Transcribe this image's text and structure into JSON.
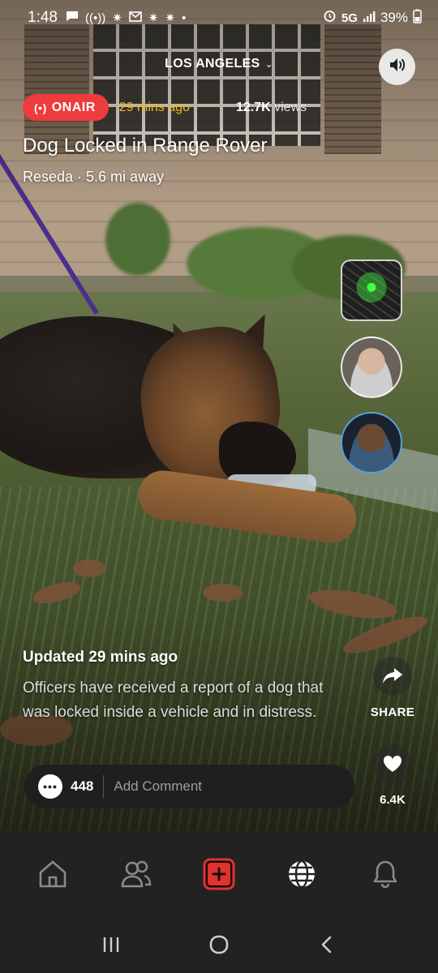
{
  "status_bar": {
    "time": "1:48",
    "network": "5G",
    "battery": "39%"
  },
  "header": {
    "location": "LOS ANGELES"
  },
  "story": {
    "badge": "ONAIR",
    "time_ago": "29 mins ago",
    "views_count": "12.7K",
    "views_label": "views",
    "title": "Dog Locked in Range Rover",
    "subtitle": "Reseda · 5.6 mi away",
    "updated": "Updated 29 mins ago",
    "description": "Officers have received a report of a dog that was locked inside a vehicle and in distress."
  },
  "actions": {
    "share_label": "SHARE",
    "like_count": "6.4K"
  },
  "comments": {
    "count": "448",
    "placeholder": "Add Comment"
  },
  "bottom_nav": [
    {
      "name": "home",
      "icon": "home-icon"
    },
    {
      "name": "friends",
      "icon": "people-icon"
    },
    {
      "name": "create",
      "icon": "plus-square-icon"
    },
    {
      "name": "explore",
      "icon": "globe-icon"
    },
    {
      "name": "notifications",
      "icon": "bell-icon"
    }
  ],
  "colors": {
    "onair_red": "#ee3b3b",
    "time_ago_yellow": "#f6b81c",
    "nav_background": "#222222",
    "create_button_red": "#e0322f"
  }
}
